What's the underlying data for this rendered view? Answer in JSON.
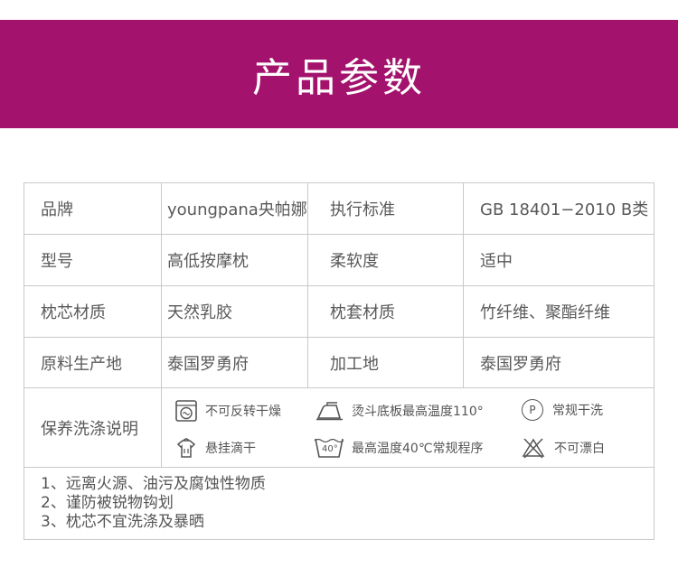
{
  "banner": {
    "title": "产品参数"
  },
  "spec_rows": [
    {
      "label1": "品牌",
      "value1": "youngpana央帕娜",
      "label2": "执行标准",
      "value2": "GB 18401−2010 B类"
    },
    {
      "label1": "型号",
      "value1": "高低按摩枕",
      "label2": "柔软度",
      "value2": "适中"
    },
    {
      "label1": "枕芯材质",
      "value1": "天然乳胶",
      "label2": "枕套材质",
      "value2": "竹纤维、聚酯纤维"
    },
    {
      "label1": "原料生产地",
      "value1": "泰国罗勇府",
      "label2": "加工地",
      "value2": "泰国罗勇府"
    }
  ],
  "care": {
    "label": "保养洗涤说明",
    "items": [
      {
        "icon": "no-tumble-dry-icon",
        "text": "不可反转干燥"
      },
      {
        "icon": "iron-icon",
        "text": "烫斗底板最高温度110°"
      },
      {
        "icon": "dry-clean-p-icon",
        "text": "常规干洗",
        "icon_text": "P"
      },
      {
        "icon": "hang-dry-icon",
        "text": "悬挂滴干"
      },
      {
        "icon": "wash-40-icon",
        "text": "最高温度40℃常规程序",
        "icon_text": "40°"
      },
      {
        "icon": "no-bleach-icon",
        "text": "不可漂白"
      }
    ]
  },
  "notes": [
    "1、远离火源、油污及腐蚀性物质",
    "2、谨防被锐物钩划",
    "3、枕芯不宜洗涤及暴晒"
  ],
  "colors": {
    "banner": "#a3126c",
    "border": "#c9c9c9",
    "text": "#595959"
  }
}
